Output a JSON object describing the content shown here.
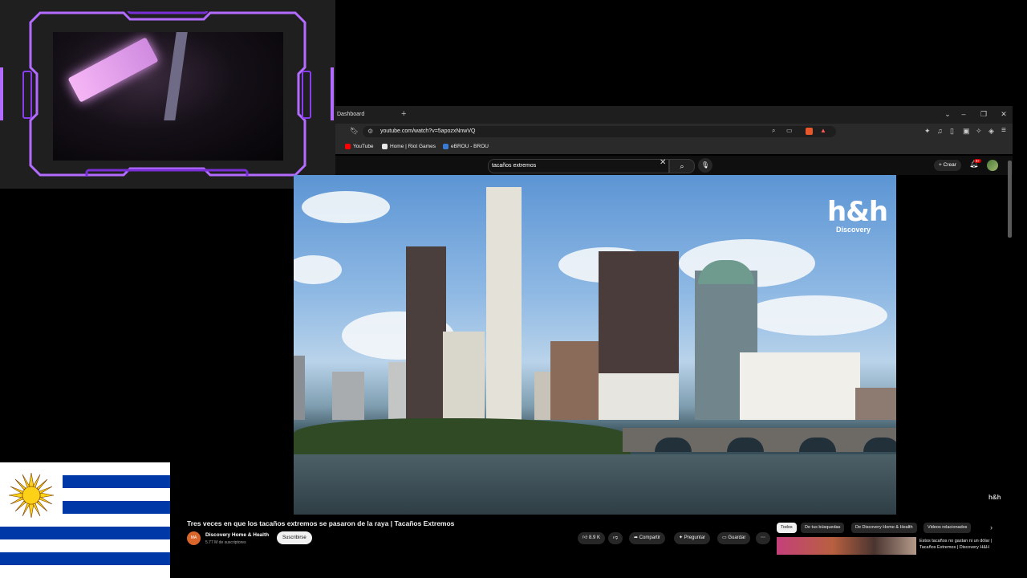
{
  "browser": {
    "tab_title": "Dashboard",
    "url": "youtube.com/watch?v=5apozxNnwVQ",
    "bookmarks": [
      {
        "label": "YouTube",
        "color": "#ff0000"
      },
      {
        "label": "Home | Riot Games",
        "color": "#e8e8e8"
      },
      {
        "label": "eBROU - BROU",
        "color": "#3a7bd5"
      }
    ]
  },
  "header": {
    "search_query": "tacaños extremos",
    "create_label": "Crear",
    "notifications_badge": "9+"
  },
  "video": {
    "logo_main": "h&h",
    "logo_sub": "Discovery",
    "watermark": "h&h",
    "title": "Tres veces en que los tacaños extremos se pasaron de la raya | Tacaños Extremos",
    "channel_initials": "MA",
    "channel_name": "Discovery Home & Health",
    "subscribers": "5.77 M de suscriptores",
    "subscribe_label": "Suscribirse",
    "likes": "8.9 K",
    "share_label": "Compartir",
    "ask_label": "Preguntar",
    "save_label": "Guardar"
  },
  "sidebar": {
    "chips": [
      "Todos",
      "De tus búsquedas",
      "De Discovery Home & Health",
      "Videos relacionados"
    ],
    "recommendation_title": "Estos tacaños no gastan ni un dólar | Tacaños Extremos | Discovery H&H"
  },
  "colors": {
    "flag_blue": "#0038a8",
    "sun": "#fcd116",
    "overlay_purple": "#8a3cf0"
  }
}
